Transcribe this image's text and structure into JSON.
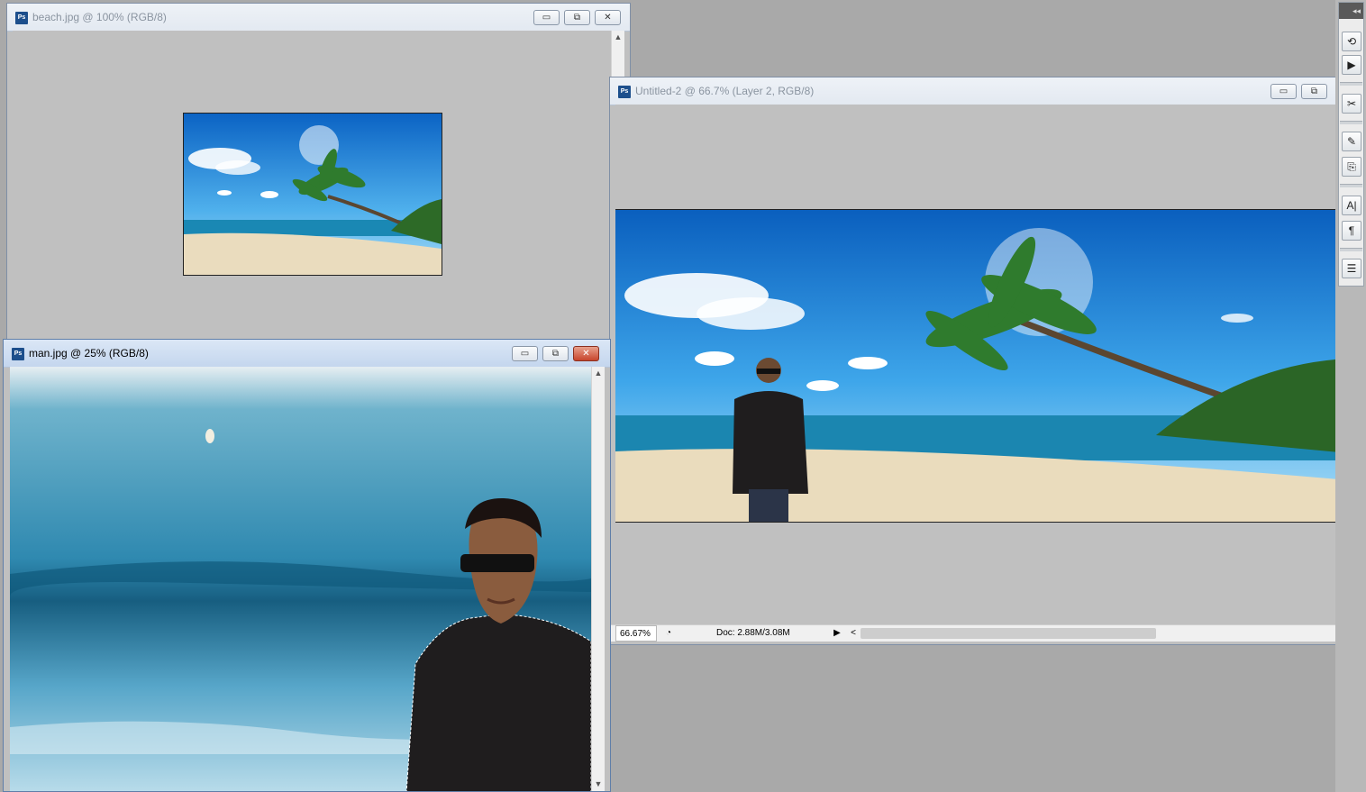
{
  "windows": {
    "beach": {
      "title": "beach.jpg @ 100% (RGB/8)",
      "minimize": "▭",
      "restore": "⧉",
      "close": "✕"
    },
    "man": {
      "title": "man.jpg @ 25% (RGB/8)",
      "minimize": "▭",
      "restore": "⧉",
      "close": "✕"
    },
    "untitled": {
      "title": "Untitled-2 @ 66.7% (Layer 2, RGB/8)",
      "minimize": "▭",
      "restore": "⧉",
      "status": {
        "zoom": "66.67%",
        "doc": "Doc: 2.88M/3.08M",
        "menu_arrow": "▶",
        "scroll_left": "<",
        "scroll_right": ">"
      }
    }
  },
  "dock": {
    "collapse": "◂◂",
    "buttons": [
      {
        "name": "history-icon",
        "glyph": "⟲"
      },
      {
        "name": "actions-icon",
        "glyph": "▶"
      },
      {
        "name": "tool-presets-icon",
        "glyph": "✂"
      },
      {
        "name": "brushes-icon",
        "glyph": "✎"
      },
      {
        "name": "clone-source-icon",
        "glyph": "⎘"
      },
      {
        "name": "character-icon",
        "glyph": "A|"
      },
      {
        "name": "paragraph-icon",
        "glyph": "¶"
      },
      {
        "name": "notes-icon",
        "glyph": "☰"
      }
    ]
  },
  "colors": {
    "sky": "#1e88d6",
    "sea": "#1f7fa8",
    "sand": "#e9dcc0",
    "palm": "#2f6b2a",
    "hoodie": "#1f1d1e"
  }
}
